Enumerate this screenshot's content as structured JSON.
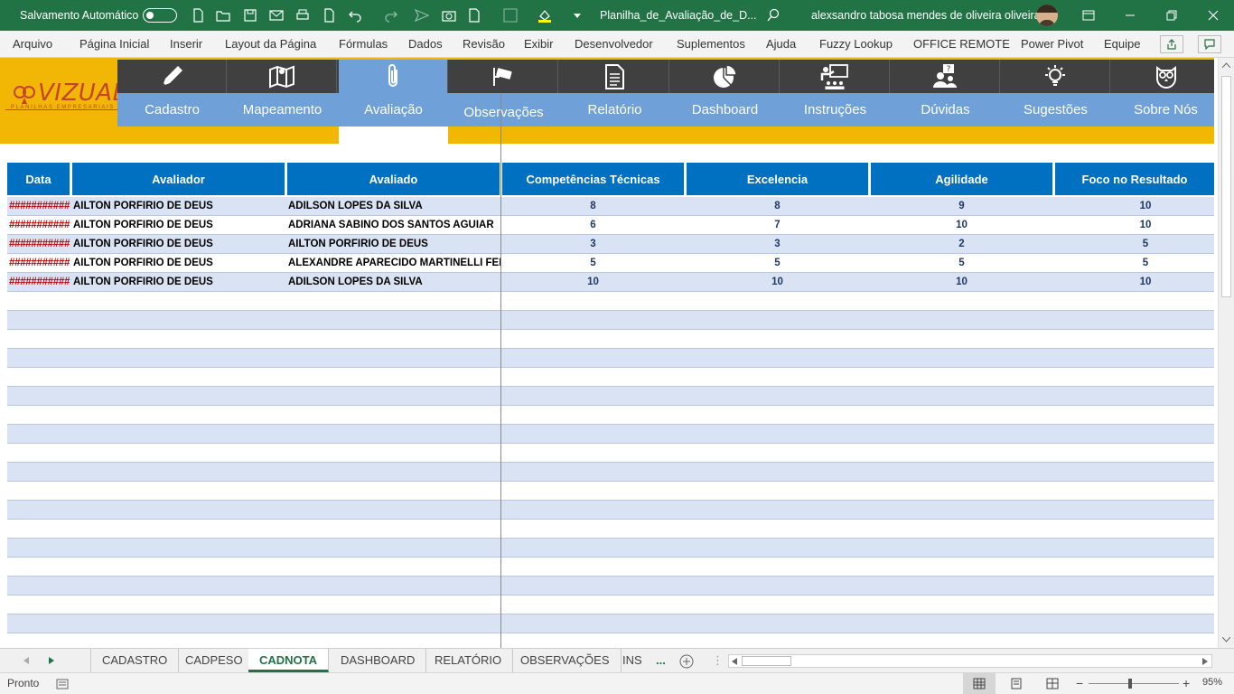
{
  "titlebar": {
    "autosave_label": "Salvamento Automático",
    "filename": "Planilha_de_Avaliação_de_D...",
    "user": "alexsandro tabosa mendes de oliveira oliveira"
  },
  "menu": [
    "Arquivo",
    "Página Inicial",
    "Inserir",
    "Layout da Página",
    "Fórmulas",
    "Dados",
    "Revisão",
    "Exibir",
    "Desenvolvedor",
    "Suplementos",
    "Ajuda",
    "Fuzzy Lookup",
    "OFFICE REMOTE",
    "Power Pivot",
    "Equipe"
  ],
  "logo": {
    "text": "VIZUAL",
    "subtitle": "PLANILHAS EMPRESARIAIS"
  },
  "nav": [
    {
      "label": "Cadastro",
      "icon": "pencil-icon"
    },
    {
      "label": "Mapeamento",
      "icon": "map-icon"
    },
    {
      "label": "Avaliação",
      "icon": "paperclip-icon"
    },
    {
      "label": "Observações",
      "icon": "camera-icon"
    },
    {
      "label": "Relatório",
      "icon": "document-icon"
    },
    {
      "label": "Dashboard",
      "icon": "pie-chart-icon"
    },
    {
      "label": "Instruções",
      "icon": "teacher-icon"
    },
    {
      "label": "Dúvidas",
      "icon": "question-people-icon"
    },
    {
      "label": "Sugestões",
      "icon": "lightbulb-icon"
    },
    {
      "label": "Sobre Nós",
      "icon": "owl-icon"
    }
  ],
  "nav_active": "Avaliação",
  "table": {
    "headers": [
      "Data",
      "Avaliador",
      "Avaliado",
      "Competências Técnicas",
      "Excelencia",
      "Agilidade",
      "Foco no Resultado"
    ],
    "rows": [
      [
        "###########",
        "AILTON PORFIRIO DE DEUS",
        "ADILSON LOPES DA SILVA",
        "8",
        "8",
        "9",
        "10"
      ],
      [
        "###########",
        "AILTON PORFIRIO DE DEUS",
        "ADRIANA SABINO DOS SANTOS AGUIAR",
        "6",
        "7",
        "10",
        "10"
      ],
      [
        "###########",
        "AILTON PORFIRIO DE DEUS",
        "AILTON PORFIRIO DE DEUS",
        "3",
        "3",
        "2",
        "5"
      ],
      [
        "###########",
        "AILTON PORFIRIO DE DEUS",
        "ALEXANDRE APARECIDO MARTINELLI FERREIRA",
        "5",
        "5",
        "5",
        "5"
      ],
      [
        "###########",
        "AILTON PORFIRIO DE DEUS",
        "ADILSON LOPES DA SILVA",
        "10",
        "10",
        "10",
        "10"
      ]
    ]
  },
  "sheet_tabs": [
    "CADASTRO",
    "CADPESO",
    "CADNOTA",
    "DASHBOARD",
    "RELATÓRIO",
    "OBSERVAÇÕES",
    "INS"
  ],
  "active_tab": "CADNOTA",
  "tabs_more": "...",
  "status": {
    "ready": "Pronto",
    "zoom": "95%"
  },
  "colors": {
    "excel_green": "#217346",
    "header_blue": "#0070c0",
    "row_alt": "#dae3f3",
    "gold": "#f2b705",
    "nav_blue": "#6fa0d8",
    "nav_dark": "#404040"
  }
}
